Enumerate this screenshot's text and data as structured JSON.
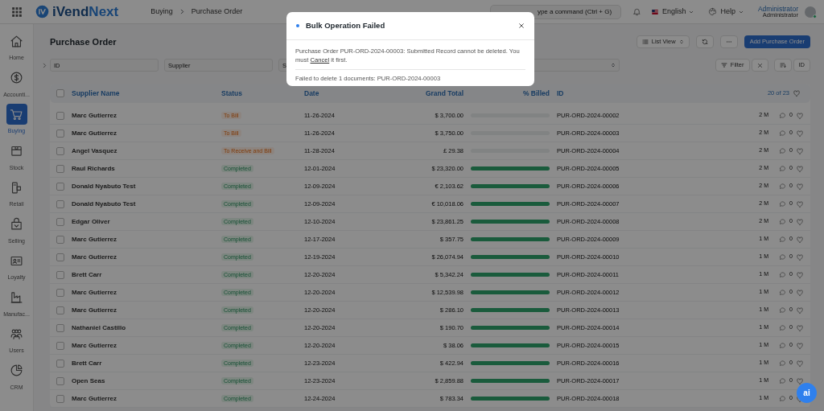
{
  "topbar": {
    "logo": {
      "first": "iVend",
      "second": "Next"
    },
    "breadcrumbs": [
      "Buying",
      "Purchase Order"
    ],
    "search": {
      "placeholder": "ype a command (Ctrl + G)"
    },
    "language": "English",
    "help": "Help",
    "user": {
      "name": "Administrator",
      "role": "Administrator",
      "online": true
    }
  },
  "sidebar": {
    "items": [
      {
        "label": "Home",
        "selected": false
      },
      {
        "label": "Accounti...",
        "selected": false
      },
      {
        "label": "Buying",
        "selected": true
      },
      {
        "label": "Stock",
        "selected": false
      },
      {
        "label": "Retail",
        "selected": false
      },
      {
        "label": "Selling",
        "selected": false
      },
      {
        "label": "Loyalty",
        "selected": false
      },
      {
        "label": "Manufac...",
        "selected": false
      },
      {
        "label": "Users",
        "selected": false
      },
      {
        "label": "CRM",
        "selected": false
      }
    ]
  },
  "page": {
    "title": "Purchase Order",
    "view_button": "List View",
    "primary_button": "Add Purchase Order"
  },
  "filters": {
    "fields": [
      {
        "placeholder": "ID"
      },
      {
        "placeholder": "Supplier"
      },
      {
        "placeholder": "S"
      }
    ],
    "filter_button": "Filter",
    "sort_button": "ID"
  },
  "table": {
    "select_all_checked": false,
    "columns": [
      "Supplier Name",
      "Status",
      "Date",
      "Grand Total",
      "% Billed",
      "ID"
    ],
    "count": "20 of 23",
    "rows": [
      {
        "supplier": "Marc Gutierrez",
        "status": {
          "text": "To Bill",
          "kind": "pending"
        },
        "date": "11-26-2024",
        "total": "$ 3,700.00",
        "level": 0,
        "id": "PUR-ORD-2024-00002",
        "checked": false,
        "modified": "2 M",
        "comments": "0"
      },
      {
        "supplier": "Marc Gutierrez",
        "status": {
          "text": "To Bill",
          "kind": "pending"
        },
        "date": "11-26-2024",
        "total": "$ 3,750.00",
        "level": 0,
        "id": "PUR-ORD-2024-00003",
        "checked": false,
        "modified": "2 M",
        "comments": "0"
      },
      {
        "supplier": "Angel Vasquez",
        "status": {
          "text": "To Receive and Bill",
          "kind": "pending"
        },
        "date": "11-28-2024",
        "total": "£ 29.38",
        "level": 0,
        "id": "PUR-ORD-2024-00004",
        "checked": false,
        "modified": "2 M",
        "comments": "0"
      },
      {
        "supplier": "Raul Richards",
        "status": {
          "text": "Completed",
          "kind": "done"
        },
        "date": "12-01-2024",
        "total": "$ 23,320.00",
        "level": 1,
        "id": "PUR-ORD-2024-00005",
        "checked": false,
        "modified": "2 M",
        "comments": "0"
      },
      {
        "supplier": "Donald Nyabuto Test",
        "status": {
          "text": "Completed",
          "kind": "done"
        },
        "date": "12-09-2024",
        "total": "€ 2,103.62",
        "level": 1,
        "id": "PUR-ORD-2024-00006",
        "checked": false,
        "modified": "2 M",
        "comments": "0"
      },
      {
        "supplier": "Donald Nyabuto Test",
        "status": {
          "text": "Completed",
          "kind": "done"
        },
        "date": "12-09-2024",
        "total": "€ 10,018.06",
        "level": 1,
        "id": "PUR-ORD-2024-00007",
        "checked": false,
        "modified": "2 M",
        "comments": "0"
      },
      {
        "supplier": "Edgar Oliver",
        "status": {
          "text": "Completed",
          "kind": "done"
        },
        "date": "12-10-2024",
        "total": "$ 23,861.25",
        "level": 1,
        "id": "PUR-ORD-2024-00008",
        "checked": false,
        "modified": "2 M",
        "comments": "0"
      },
      {
        "supplier": "Marc Gutierrez",
        "status": {
          "text": "Completed",
          "kind": "done"
        },
        "date": "12-17-2024",
        "total": "$ 357.75",
        "level": 1,
        "id": "PUR-ORD-2024-00009",
        "checked": false,
        "modified": "1 M",
        "comments": "0"
      },
      {
        "supplier": "Marc Gutierrez",
        "status": {
          "text": "Completed",
          "kind": "done"
        },
        "date": "12-19-2024",
        "total": "$ 26,074.94",
        "level": 1,
        "id": "PUR-ORD-2024-00010",
        "checked": false,
        "modified": "1 M",
        "comments": "0"
      },
      {
        "supplier": "Brett Carr",
        "status": {
          "text": "Completed",
          "kind": "done"
        },
        "date": "12-20-2024",
        "total": "$ 5,342.24",
        "level": 1,
        "id": "PUR-ORD-2024-00011",
        "checked": false,
        "modified": "1 M",
        "comments": "0"
      },
      {
        "supplier": "Marc Gutierrez",
        "status": {
          "text": "Completed",
          "kind": "done"
        },
        "date": "12-20-2024",
        "total": "$ 12,539.98",
        "level": 1,
        "id": "PUR-ORD-2024-00012",
        "checked": false,
        "modified": "1 M",
        "comments": "0"
      },
      {
        "supplier": "Marc Gutierrez",
        "status": {
          "text": "Completed",
          "kind": "done"
        },
        "date": "12-20-2024",
        "total": "$ 286.10",
        "level": 1,
        "id": "PUR-ORD-2024-00013",
        "checked": false,
        "modified": "1 M",
        "comments": "0"
      },
      {
        "supplier": "Nathaniel Castillo",
        "status": {
          "text": "Completed",
          "kind": "done"
        },
        "date": "12-20-2024",
        "total": "$ 190.70",
        "level": 1,
        "id": "PUR-ORD-2024-00014",
        "checked": false,
        "modified": "1 M",
        "comments": "0"
      },
      {
        "supplier": "Marc Gutierrez",
        "status": {
          "text": "Completed",
          "kind": "done"
        },
        "date": "12-20-2024",
        "total": "$ 38.06",
        "level": 1,
        "id": "PUR-ORD-2024-00015",
        "checked": false,
        "modified": "1 M",
        "comments": "0"
      },
      {
        "supplier": "Brett Carr",
        "status": {
          "text": "Completed",
          "kind": "done"
        },
        "date": "12-23-2024",
        "total": "$ 422.94",
        "level": 1,
        "id": "PUR-ORD-2024-00016",
        "checked": false,
        "modified": "1 M",
        "comments": "0"
      },
      {
        "supplier": "Open Seas",
        "status": {
          "text": "Completed",
          "kind": "done"
        },
        "date": "12-23-2024",
        "total": "$ 2,859.88",
        "level": 1,
        "id": "PUR-ORD-2024-00017",
        "checked": false,
        "modified": "1 M",
        "comments": "0"
      },
      {
        "supplier": "Marc Gutierrez",
        "status": {
          "text": "Completed",
          "kind": "done"
        },
        "date": "12-24-2024",
        "total": "$ 783.34",
        "level": 1,
        "id": "PUR-ORD-2024-00018",
        "checked": false,
        "modified": "1 M",
        "comments": "0"
      }
    ]
  },
  "modal": {
    "title": "Bulk Operation Failed",
    "message_before": "Purchase Order PUR-ORD-2024-00003: Submitted Record cannot be deleted. You must ",
    "link": "Cancel",
    "message_after": " it first.",
    "detail": "Failed to delete 1 documents: PUR-ORD-2024-00003"
  },
  "assistant_button": "ai"
}
